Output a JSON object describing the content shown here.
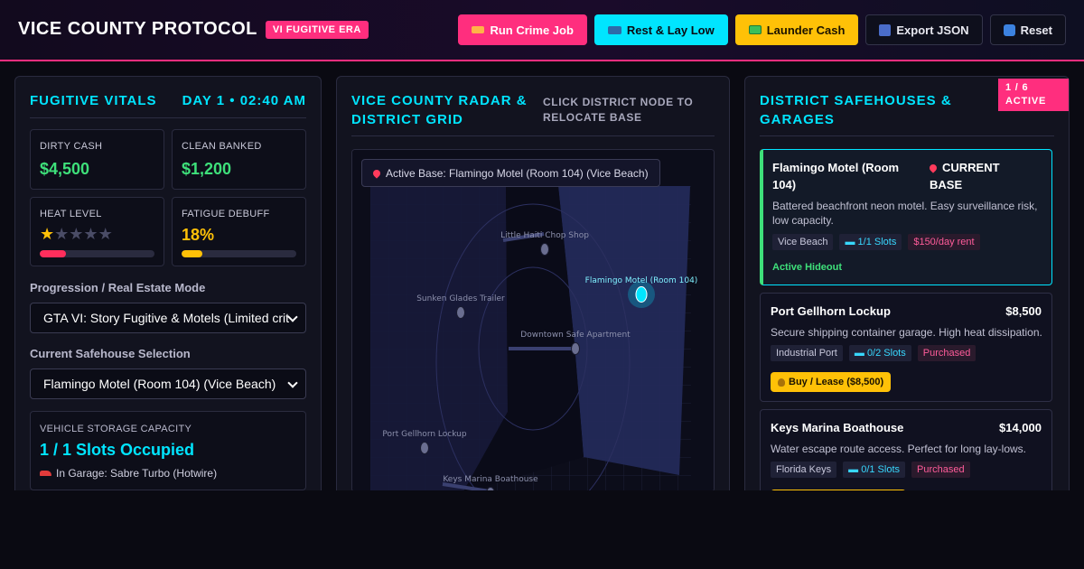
{
  "header": {
    "title": "VICE COUNTY PROTOCOL",
    "badge": "VI FUGITIVE ERA",
    "buttons": [
      {
        "label": "Run Crime Job",
        "icon": "gun-icon"
      },
      {
        "label": "Rest & Lay Low",
        "icon": "bed-icon"
      },
      {
        "label": "Launder Cash",
        "icon": "cash-icon"
      },
      {
        "label": "Export JSON",
        "icon": "floppy-disk-icon"
      },
      {
        "label": "Reset",
        "icon": "reset-icon"
      }
    ]
  },
  "vitals": {
    "title": "FUGITIVE VITALS",
    "clock": "DAY 1 • 02:40 AM",
    "dirty_cash_label": "DIRTY CASH",
    "dirty_cash": "$4,500",
    "clean_banked_label": "CLEAN BANKED",
    "clean_banked": "$1,200",
    "heat_label": "HEAT LEVEL",
    "heat_stars": 1,
    "heat_max_stars": 5,
    "heat_fraction": 0.23,
    "fatigue_label": "FATIGUE DEBUFF",
    "fatigue": "18%",
    "fatigue_fraction": 0.18,
    "mode_label": "Progression / Real Estate Mode",
    "mode_value": "GTA VI: Story Fugitive & Motels (Limited crit",
    "safehouse_label": "Current Safehouse Selection",
    "safehouse_value": "Flamingo Motel (Room 104) (Vice Beach)",
    "storage_label": "VEHICLE STORAGE CAPACITY",
    "storage_value": "1 / 1 Slots Occupied",
    "garage_line": "In Garage: Sabre Turbo (Hotwire)"
  },
  "radar": {
    "title_line1": "VICE COUNTY RADAR &",
    "title_line2": "DISTRICT GRID",
    "hint_line1": "CLICK DISTRICT NODE TO",
    "hint_line2": "RELOCATE BASE",
    "active_base": "Active Base: Flamingo Motel (Room 104) (Vice Beach)",
    "nodes": [
      {
        "label": "Little Haiti Chop Shop",
        "active": false
      },
      {
        "label": "Flamingo Motel (Room 104)",
        "active": true
      },
      {
        "label": "Sunken Glades Trailer",
        "active": false
      },
      {
        "label": "Downtown Safe Apartment",
        "active": false
      },
      {
        "label": "Port Gellhorn Lockup",
        "active": false
      },
      {
        "label": "Keys Marina Boathouse",
        "active": false
      }
    ]
  },
  "safehouses": {
    "title_line1": "DISTRICT SAFEHOUSES &",
    "title_line2": "GARAGES",
    "count_line1": "1 / 6",
    "count_line2": "ACTIVE",
    "cards": [
      {
        "name_line1": "Flamingo Motel (Room",
        "name_line2": "104)",
        "status_line1": "CURRENT",
        "status_line2": "BASE",
        "desc_line1": "Battered beachfront neon motel. Easy surveillance risk,",
        "desc_line2": "low capacity.",
        "district": "Vice Beach",
        "slots": "1/1 Slots",
        "extra": "$150/day rent",
        "footer": "Active Hideout"
      },
      {
        "name": "Port Gellhorn Lockup",
        "price": "$8,500",
        "desc": "Secure shipping container garage. High heat dissipation.",
        "district": "Industrial Port",
        "slots": "0/2 Slots",
        "extra": "Purchased",
        "buy_label": "Buy / Lease ($8,500)"
      },
      {
        "name": "Keys Marina Boathouse",
        "price": "$14,000",
        "desc": "Water escape route access. Perfect for long lay-lows.",
        "district": "Florida Keys",
        "slots": "0/1 Slots",
        "extra": "Purchased"
      }
    ]
  },
  "colors": {
    "accent_pink": "#ff2e7e",
    "accent_cyan": "#00e5ff",
    "accent_yellow": "#ffc107",
    "money_green": "#3ee07a",
    "heat_red": "#ff2e5c"
  }
}
